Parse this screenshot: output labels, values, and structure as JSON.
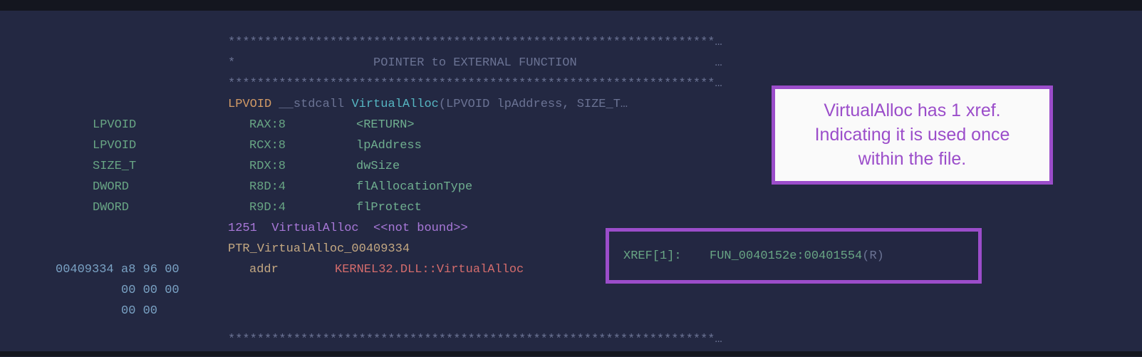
{
  "header": {
    "stars_top": "*******************************************************************…",
    "title_line": "*                   POINTER to EXTERNAL FUNCTION                   …",
    "stars_bottom": "*******************************************************************…"
  },
  "signature": {
    "ret_type": "LPVOID ",
    "callconv": "__stdcall ",
    "funcname": "VirtualAlloc",
    "params": "(LPVOID lpAddress, SIZE_T…"
  },
  "params": [
    {
      "type": "LPVOID",
      "reg": "RAX:8",
      "name": "<RETURN>"
    },
    {
      "type": "LPVOID",
      "reg": "RCX:8",
      "name": "lpAddress"
    },
    {
      "type": "SIZE_T",
      "reg": "RDX:8",
      "name": "dwSize"
    },
    {
      "type": "DWORD",
      "reg": "R8D:4",
      "name": "flAllocationType"
    },
    {
      "type": "DWORD",
      "reg": "R9D:4",
      "name": "flProtect"
    }
  ],
  "ordinal_line": {
    "ord": "1251",
    "name": "VirtualAlloc",
    "bound": "<<not bound>>"
  },
  "label_line": "PTR_VirtualAlloc_00409334",
  "xref": {
    "prefix": "XREF[1]:",
    "ref": "FUN_0040152e:00401554",
    "suffix": "(R)"
  },
  "addr_line": {
    "addr": "00409334",
    "bytes1": "a8 96 00",
    "kw": "addr",
    "target": "KERNEL32.DLL::VirtualAlloc",
    "bytes2": "00 00 00",
    "bytes3": "00 00"
  },
  "callout": {
    "l1": "VirtualAlloc has 1 xref.",
    "l2": "Indicating it is used once",
    "l3": "within the file."
  },
  "footer_stars": "*******************************************************************…"
}
